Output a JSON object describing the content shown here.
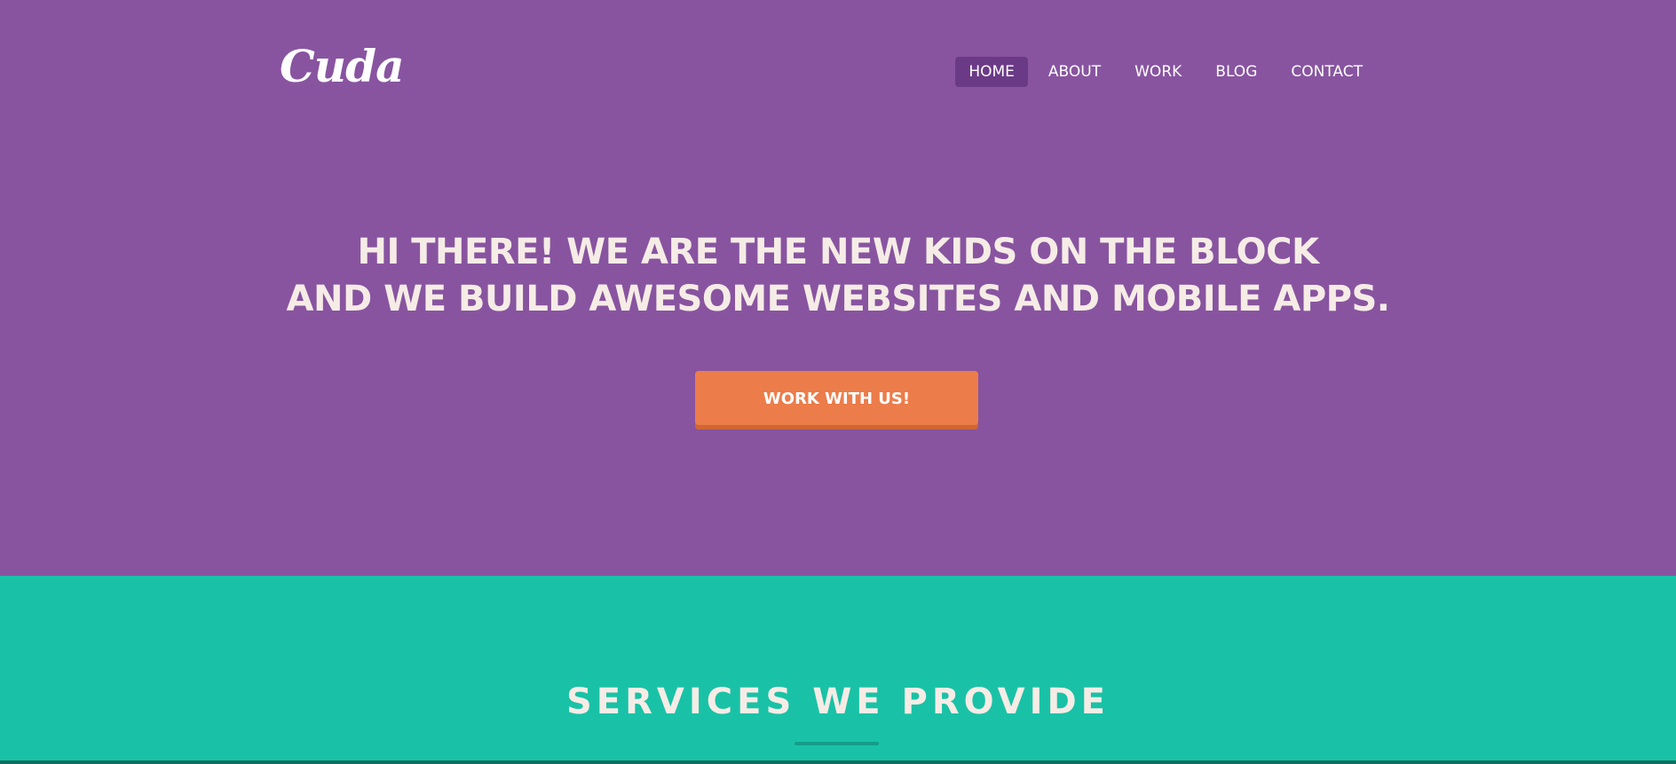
{
  "header": {
    "logo": "Cuda",
    "nav": [
      {
        "label": "HOME",
        "active": true
      },
      {
        "label": "ABOUT",
        "active": false
      },
      {
        "label": "WORK",
        "active": false
      },
      {
        "label": "BLOG",
        "active": false
      },
      {
        "label": "CONTACT",
        "active": false
      }
    ]
  },
  "hero": {
    "headline_line1": "HI THERE! WE ARE THE NEW KIDS ON THE BLOCK",
    "headline_line2": "AND WE BUILD AWESOME WEBSITES AND MOBILE APPS.",
    "cta_label": "WORK WITH US!"
  },
  "services": {
    "title": "SERVICES WE PROVIDE"
  },
  "colors": {
    "hero_bg": "#8854a0",
    "nav_active_bg": "#6b3a86",
    "cta_bg": "#ec7c4a",
    "services_bg": "#19c2a6",
    "headline_text": "#f6ece6"
  }
}
